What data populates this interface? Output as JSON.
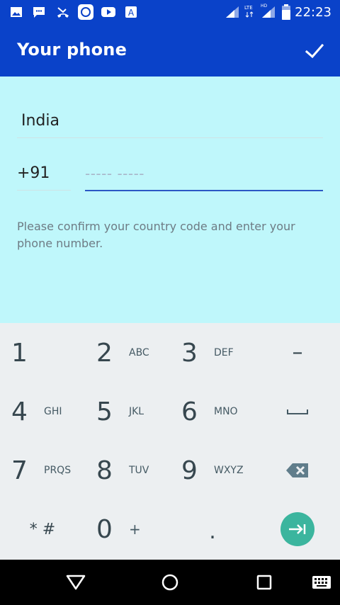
{
  "status_bar": {
    "time": "22:23",
    "icons": [
      "image-icon",
      "message-icon",
      "missed-call-icon",
      "app-icon",
      "youtube-icon",
      "keyboard-a-icon",
      "signal-icon",
      "lte-icon",
      "hd-signal-icon",
      "battery-icon"
    ],
    "lte_label": "LTE",
    "hd_label": "HD"
  },
  "app_bar": {
    "title": "Your phone",
    "confirm_icon": "check-icon"
  },
  "form": {
    "country": "India",
    "country_code": "+91",
    "phone_placeholder": "----- -----",
    "hint": "Please confirm your country code and enter your phone number."
  },
  "keypad": {
    "keys": [
      {
        "num": "1",
        "letters": ""
      },
      {
        "num": "2",
        "letters": "ABC"
      },
      {
        "num": "3",
        "letters": "DEF"
      },
      {
        "num": "4",
        "letters": "GHI"
      },
      {
        "num": "5",
        "letters": "JKL"
      },
      {
        "num": "6",
        "letters": "MNO"
      },
      {
        "num": "7",
        "letters": "PRQS"
      },
      {
        "num": "8",
        "letters": "TUV"
      },
      {
        "num": "9",
        "letters": "WXYZ"
      },
      {
        "num": "0",
        "letters": "+"
      }
    ],
    "dash": "–",
    "star_hash": "* #",
    "period": ".",
    "space_icon": "space-icon",
    "backspace_icon": "backspace-icon",
    "next_icon": "next-tab-icon",
    "accent": "#3bb59e"
  },
  "nav_bar": {
    "icons": [
      "back-icon",
      "home-icon",
      "recents-icon",
      "keyboard-icon"
    ]
  }
}
